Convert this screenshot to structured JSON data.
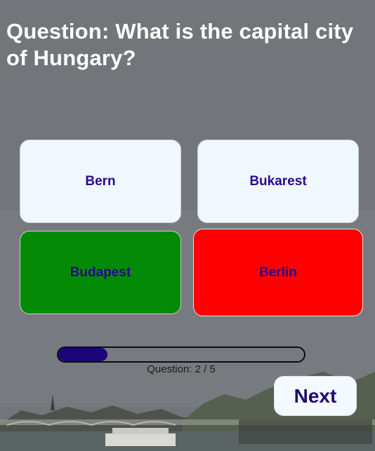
{
  "question": {
    "text": "Question: What is the capital city of Hungary?"
  },
  "answers": [
    {
      "label": "Bern",
      "state": "neutral"
    },
    {
      "label": "Bukarest",
      "state": "neutral"
    },
    {
      "label": "Budapest",
      "state": "correct"
    },
    {
      "label": "Berlin",
      "state": "wrong"
    }
  ],
  "progress": {
    "fraction": 0.2,
    "counter_text": "Question: 2 / 5"
  },
  "next_button": {
    "label": "Next"
  },
  "colors": {
    "answer_neutral": "#f0f7ff",
    "answer_correct": "#028a05",
    "answer_wrong": "#ff0000",
    "answer_text": "#2a0a8a",
    "progress_fill": "#1c0578"
  }
}
